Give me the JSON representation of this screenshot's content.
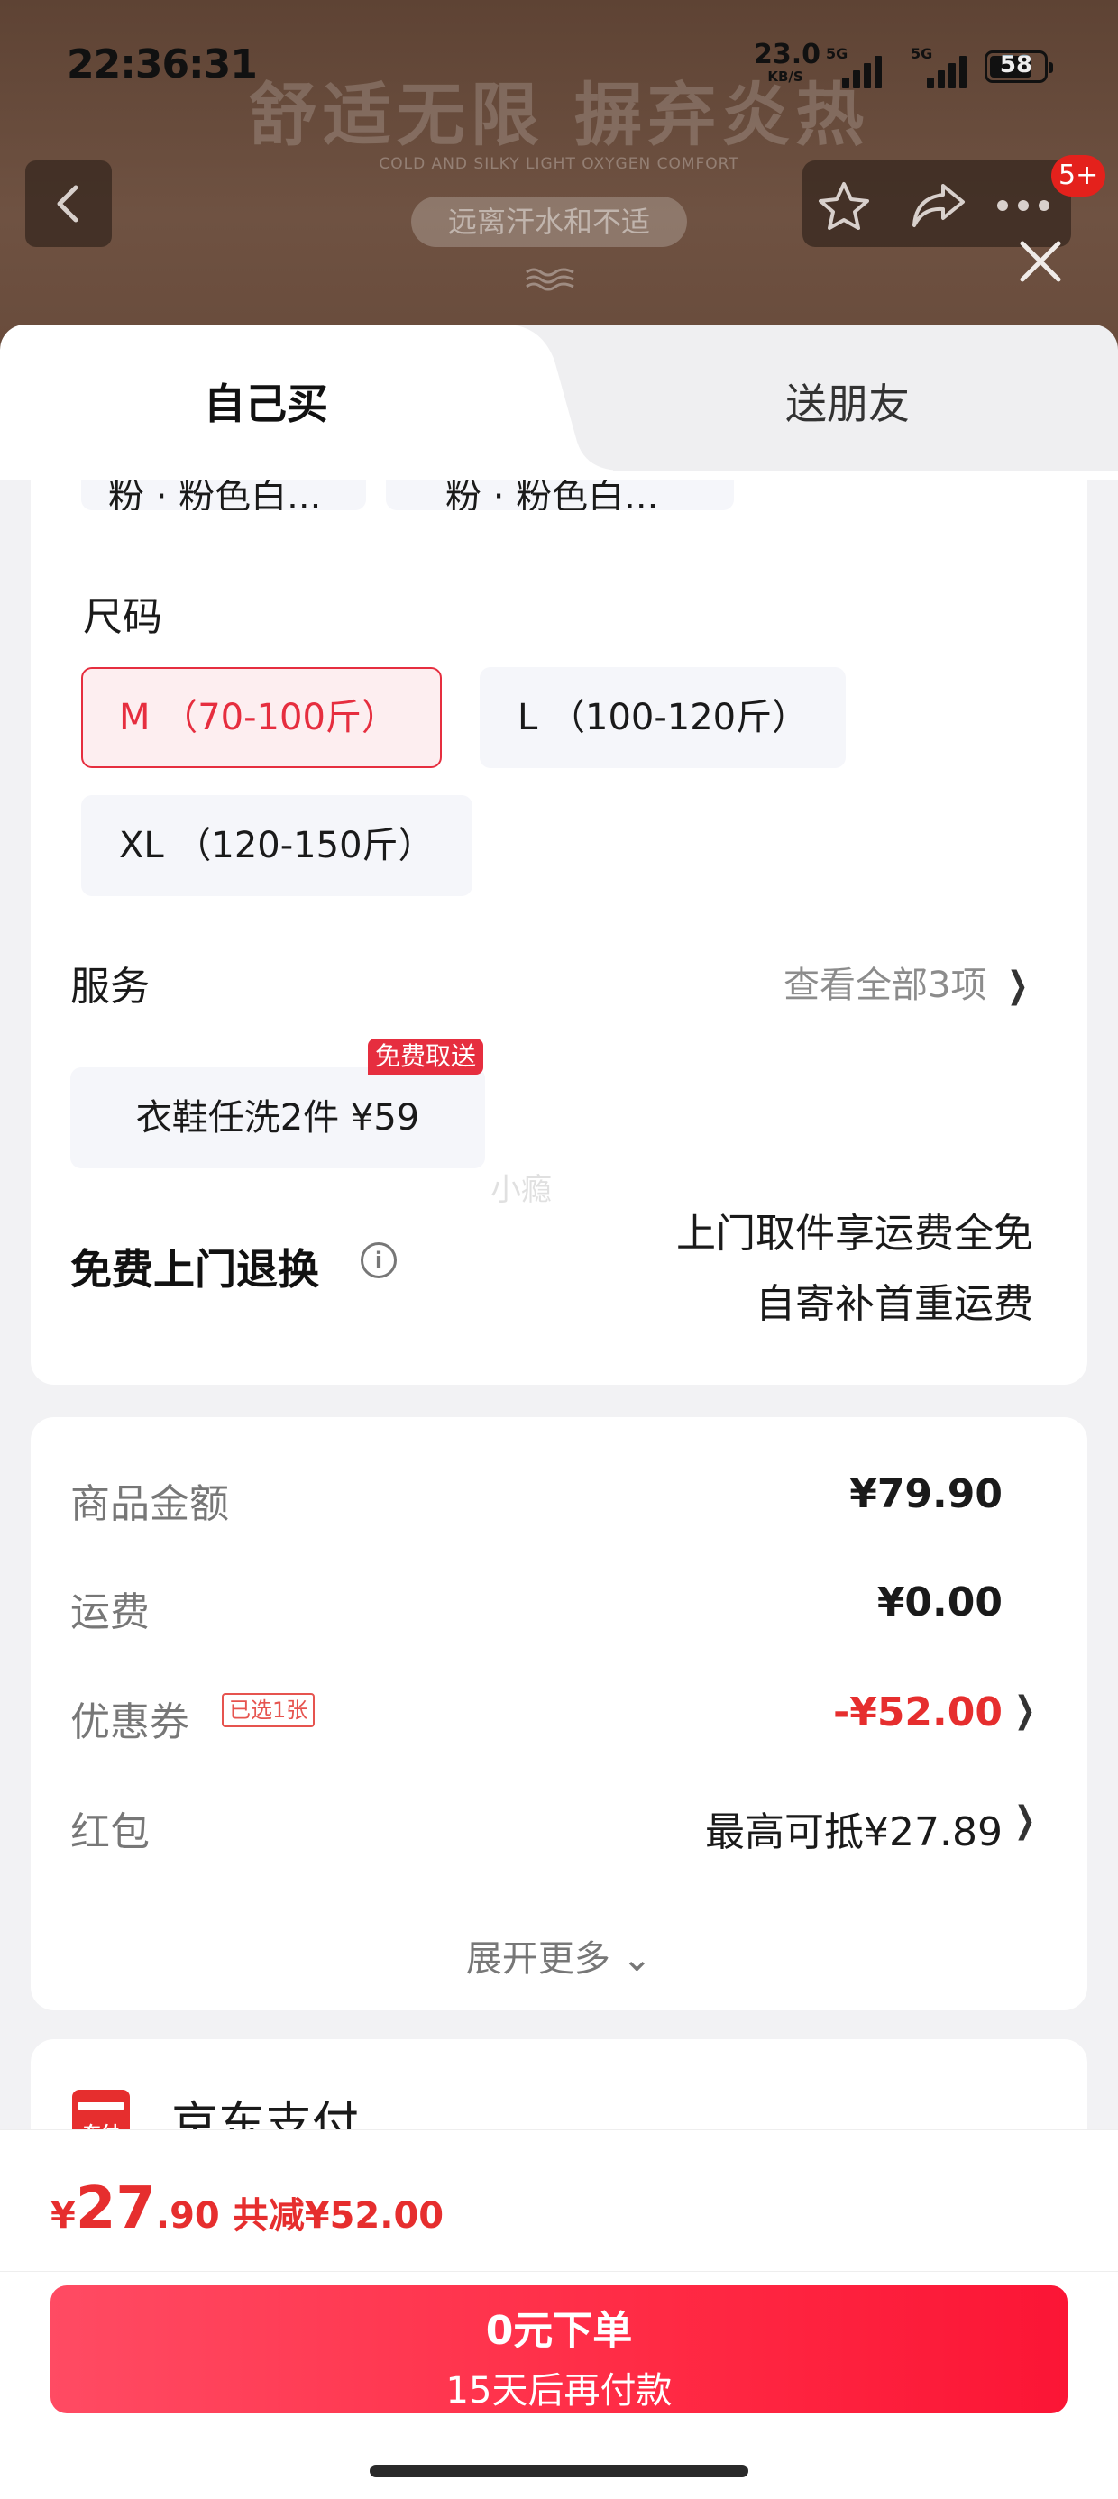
{
  "status_bar": {
    "time": "22:36:31",
    "net_speed_value": "23.0",
    "net_speed_unit": "KB/S",
    "signal1_label": "5G",
    "signal2_label": "5G",
    "battery": "58"
  },
  "banner": {
    "headline": "舒适无限 摒弃炎热",
    "subline": "COLD AND SILKY LIGHT OXYGEN COMFORT",
    "pill": "远离汗水和不适",
    "notification_count": "5+"
  },
  "tabs": {
    "self": "自己买",
    "friend": "送朋友"
  },
  "color_options_cut": [
    "粉 · 粉色白...",
    "粉 · 粉色白..."
  ],
  "size": {
    "title": "尺码",
    "options": [
      "M （70-100斤）",
      "L （100-120斤）",
      "XL （120-150斤）"
    ],
    "selected": "M （70-100斤）"
  },
  "service": {
    "title": "服务",
    "view_all": "查看全部3项",
    "chip": "衣鞋任洗2件 ¥59",
    "chip_tag": "免费取送"
  },
  "watermark": "小瘾",
  "returns": {
    "title": "免费上门退换",
    "line1": "上门取件享运费全免",
    "line2": "自寄补首重运费"
  },
  "summary": {
    "goods_label": "商品金额",
    "goods_value": "¥79.90",
    "shipping_label": "运费",
    "shipping_value": "¥0.00",
    "coupon_label": "优惠券",
    "coupon_badge": "已选1张",
    "coupon_value": "-¥52.00",
    "redpacket_label": "红包",
    "redpacket_value": "最高可抵¥27.89",
    "expand": "展开更多"
  },
  "payment": {
    "name": "京东支付",
    "icon_text": "东付"
  },
  "bottom": {
    "currency": "¥",
    "price_int": "27",
    "price_dec": ".90",
    "saved": "共减¥52.00",
    "button_line1": "0元下单",
    "button_line2": "15天后再付款"
  },
  "colors": {
    "accent_red": "#e62e3f",
    "price_red": "#e62e2e",
    "banner_brown": "#6f5242"
  }
}
